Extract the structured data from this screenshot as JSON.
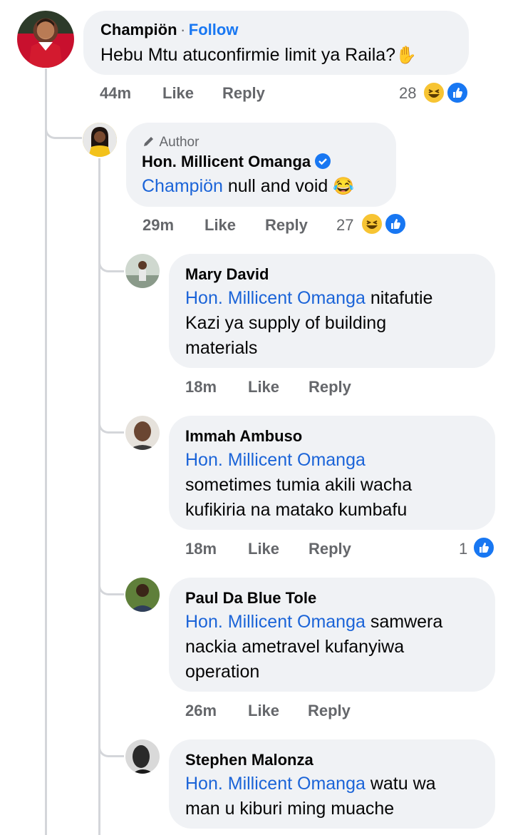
{
  "comments": [
    {
      "name": "Champiön",
      "separator": "·",
      "follow_label": "Follow",
      "text": "Hebu Mtu atuconfirmie limit ya Raila?",
      "emoji": "✋",
      "time": "44m",
      "like_label": "Like",
      "reply_label": "Reply",
      "reaction_count": "28",
      "reactions": [
        "haha-icon",
        "like-icon"
      ]
    },
    {
      "author_tag": "Author",
      "name": "Hon. Millicent Omanga",
      "verified": true,
      "mention": "Champiön",
      "text": " null and void ",
      "emoji": "😂",
      "time": "29m",
      "like_label": "Like",
      "reply_label": "Reply",
      "reaction_count": "27",
      "reactions": [
        "haha-icon",
        "like-icon"
      ]
    },
    {
      "name": "Mary David",
      "mention": "Hon. Millicent Omanga",
      "text_line1": " nitafutie",
      "text_line2": "Kazi ya supply of building",
      "text_line3": "materials",
      "time": "18m",
      "like_label": "Like",
      "reply_label": "Reply"
    },
    {
      "name": "Immah Ambuso",
      "mention": "Hon. Millicent Omanga",
      "text_line2": "sometimes tumia akili wacha",
      "text_line3": "kufikiria na matako kumbafu",
      "time": "18m",
      "like_label": "Like",
      "reply_label": "Reply",
      "reaction_count": "1",
      "reactions": [
        "like-icon"
      ]
    },
    {
      "name": "Paul Da Blue Tole",
      "mention": "Hon. Millicent Omanga",
      "text_line1": " samwera",
      "text_line2": "nackia ametravel kufanyiwa",
      "text_line3": "operation",
      "time": "26m",
      "like_label": "Like",
      "reply_label": "Reply"
    },
    {
      "name": "Stephen Malonza",
      "mention": "Hon. Millicent Omanga",
      "text_line1": " watu wa",
      "text_line2": "man u kiburi ming muache"
    }
  ],
  "colors": {
    "bubble": "#f0f2f5",
    "link": "#1b64d8",
    "follow": "#1877f2",
    "meta": "#65676b",
    "thread": "#d4d6da"
  }
}
